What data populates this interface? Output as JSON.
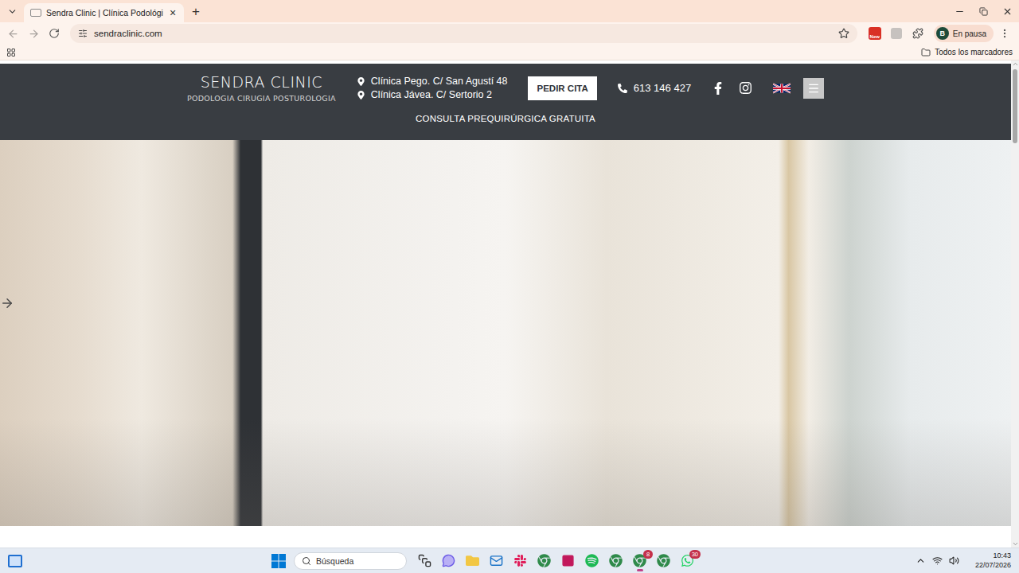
{
  "browser": {
    "tabs": [
      {
        "title": "Sendra Clinic | Clínica Podológi",
        "selected": true,
        "close": "×"
      }
    ],
    "new_tab": "+",
    "address": "sendraclinic.com",
    "bookmarked": false,
    "extension_badge": "New",
    "profile": {
      "initial": "B",
      "status": "En pausa"
    },
    "bookmarks_bar": {
      "label": "Todos los marcadores"
    }
  },
  "site": {
    "logo": {
      "name": "SENDRA CLINIC",
      "tagline": "PODOLOGIA CIRUGIA POSTUROLOGIA"
    },
    "locations": [
      "Clínica Pego. C/ San Agustí 48",
      "Clínica Jávea. C/ Sertorio 2"
    ],
    "cta": "PEDIR CITA",
    "phone": "613 146 427",
    "nav": [
      "CONSULTA PREQUIRÚRGICA GRATUITA"
    ]
  },
  "taskbar": {
    "search_placeholder": "Búsqueda",
    "apps": [
      {
        "kind": "taskview",
        "running": false,
        "badge": ""
      },
      {
        "kind": "copilot",
        "running": false,
        "badge": ""
      },
      {
        "kind": "explorer",
        "running": false,
        "badge": ""
      },
      {
        "kind": "outlook",
        "running": false,
        "badge": ""
      },
      {
        "kind": "slack",
        "running": false,
        "badge": ""
      },
      {
        "kind": "chrome",
        "running": false,
        "badge": ""
      },
      {
        "kind": "app",
        "running": false,
        "badge": ""
      },
      {
        "kind": "spotify",
        "running": false,
        "badge": ""
      },
      {
        "kind": "chrome",
        "running": false,
        "badge": ""
      },
      {
        "kind": "chrome",
        "running": true,
        "badge": "8"
      },
      {
        "kind": "chrome",
        "running": false,
        "badge": ""
      },
      {
        "kind": "whatsapp",
        "running": false,
        "badge": "30"
      }
    ],
    "clock": {
      "time": "10:43",
      "date": "22/07/2026"
    }
  }
}
